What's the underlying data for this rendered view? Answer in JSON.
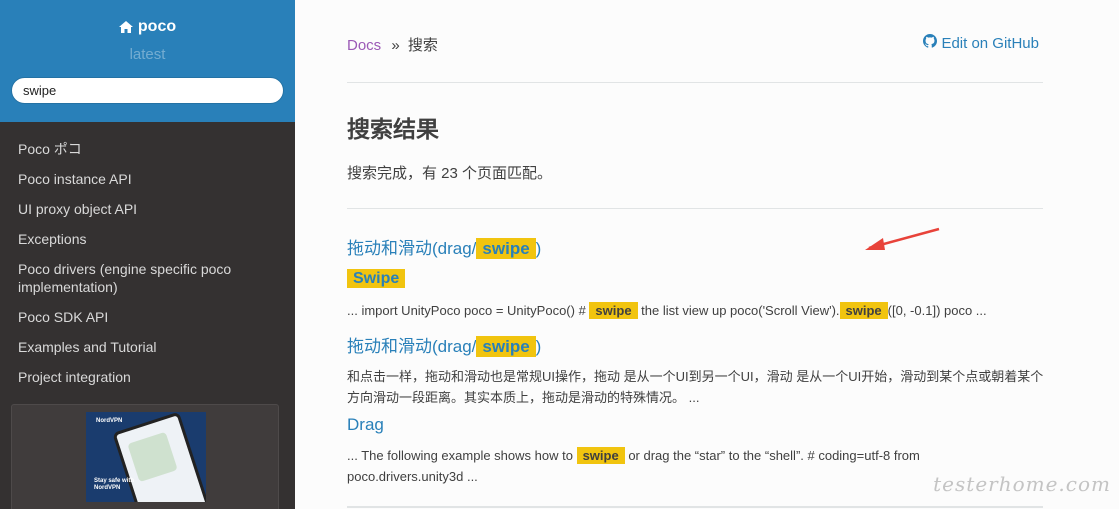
{
  "sidebar": {
    "brand": "poco",
    "version": "latest",
    "search_value": "swipe",
    "items": [
      {
        "label": "Poco ポコ"
      },
      {
        "label": "Poco instance API"
      },
      {
        "label": "UI proxy object API"
      },
      {
        "label": "Exceptions"
      },
      {
        "label": "Poco drivers (engine specific poco implementation)"
      },
      {
        "label": "Poco SDK API"
      },
      {
        "label": "Examples and Tutorial"
      },
      {
        "label": "Project integration"
      }
    ],
    "ad": {
      "logo": "NordVPN",
      "text": "Stay safe with NordVPN"
    }
  },
  "breadcrumbs": {
    "docs": "Docs",
    "separator": "»",
    "current": "搜索",
    "edit_link": "Edit on GitHub"
  },
  "page_title": "搜索结果",
  "summary": "搜索完成，有 23 个页面匹配。",
  "results": {
    "r1": {
      "title_prefix": "拖动和滑动(drag/",
      "title_highlight": "swipe",
      "title_suffix": ")",
      "sub_highlight": "Swipe",
      "ctx_a": "... import UnityPoco poco = UnityPoco() #",
      "ctx_hl1": "swipe",
      "ctx_b": "the list view up poco('Scroll View').",
      "ctx_hl2": "swipe",
      "ctx_c": "([0, -0.1]) poco ..."
    },
    "r2": {
      "title_prefix": "拖动和滑动(drag/",
      "title_highlight": "swipe",
      "title_suffix": ")",
      "context": "和点击一样，拖动和滑动也是常规UI操作，拖动 是从一个UI到另一个UI，滑动 是从一个UI开始，滑动到某个点或朝着某个方向滑动一段距离。其实本质上，拖动是滑动的特殊情况。 ..."
    },
    "r3": {
      "title": "Drag",
      "ctx_a": "... The following example shows how to",
      "ctx_hl": "swipe",
      "ctx_b": "or drag the “star” to the “shell”. # coding=utf-8 from poco.drivers.unity3d ..."
    }
  },
  "watermark": "testerhome.com",
  "colors": {
    "sidebar_top": "#2980b9",
    "sidebar_bg": "#343131",
    "link": "#2980b9",
    "highlight": "#f1c40f",
    "breadcrumb_docs": "#9b59b6",
    "arrow": "#e8433a"
  }
}
